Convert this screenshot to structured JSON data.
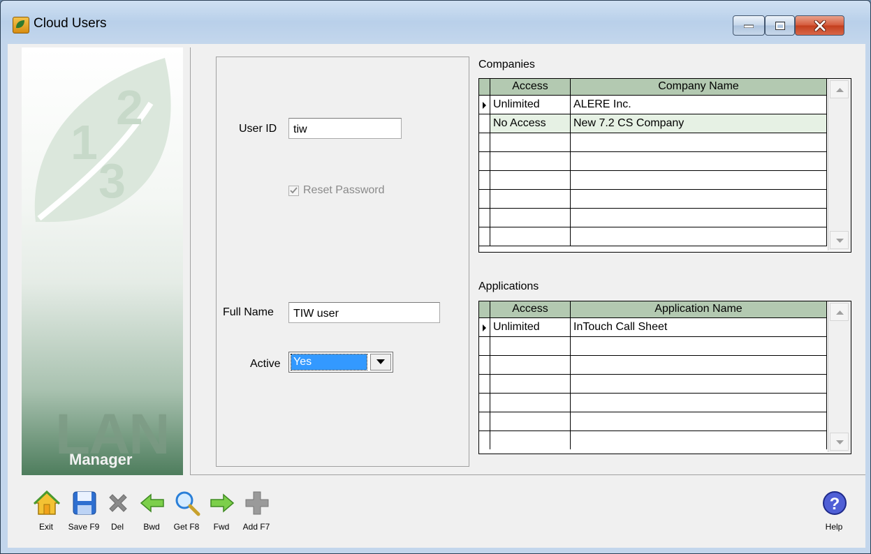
{
  "window": {
    "title": "Cloud Users"
  },
  "sidebar": {
    "logo_big": "LAN",
    "logo_small": "Manager"
  },
  "form": {
    "user_id_label": "User ID",
    "user_id_value": "tiw",
    "reset_password_label": "Reset Password",
    "reset_password_checked": true,
    "full_name_label": "Full Name",
    "full_name_value": "TIW user",
    "active_label": "Active",
    "active_value": "Yes"
  },
  "companies": {
    "title": "Companies",
    "columns": [
      "Access",
      "Company Name"
    ],
    "rows": [
      {
        "access": "Unlimited",
        "name": "ALERE Inc."
      },
      {
        "access": "No Access",
        "name": "New 7.2 CS Company"
      }
    ]
  },
  "applications": {
    "title": "Applications",
    "columns": [
      "Access",
      "Application Name"
    ],
    "rows": [
      {
        "access": "Unlimited",
        "name": "InTouch Call Sheet"
      }
    ]
  },
  "toolbar": {
    "exit": "Exit",
    "save": "Save F9",
    "del": "Del",
    "bwd": "Bwd",
    "get": "Get F8",
    "fwd": "Fwd",
    "add": "Add F7",
    "help": "Help"
  },
  "colors": {
    "grid_header": "#b3c9b1",
    "selected_row": "#e6f1e4",
    "selection_blue": "#3399ff"
  }
}
